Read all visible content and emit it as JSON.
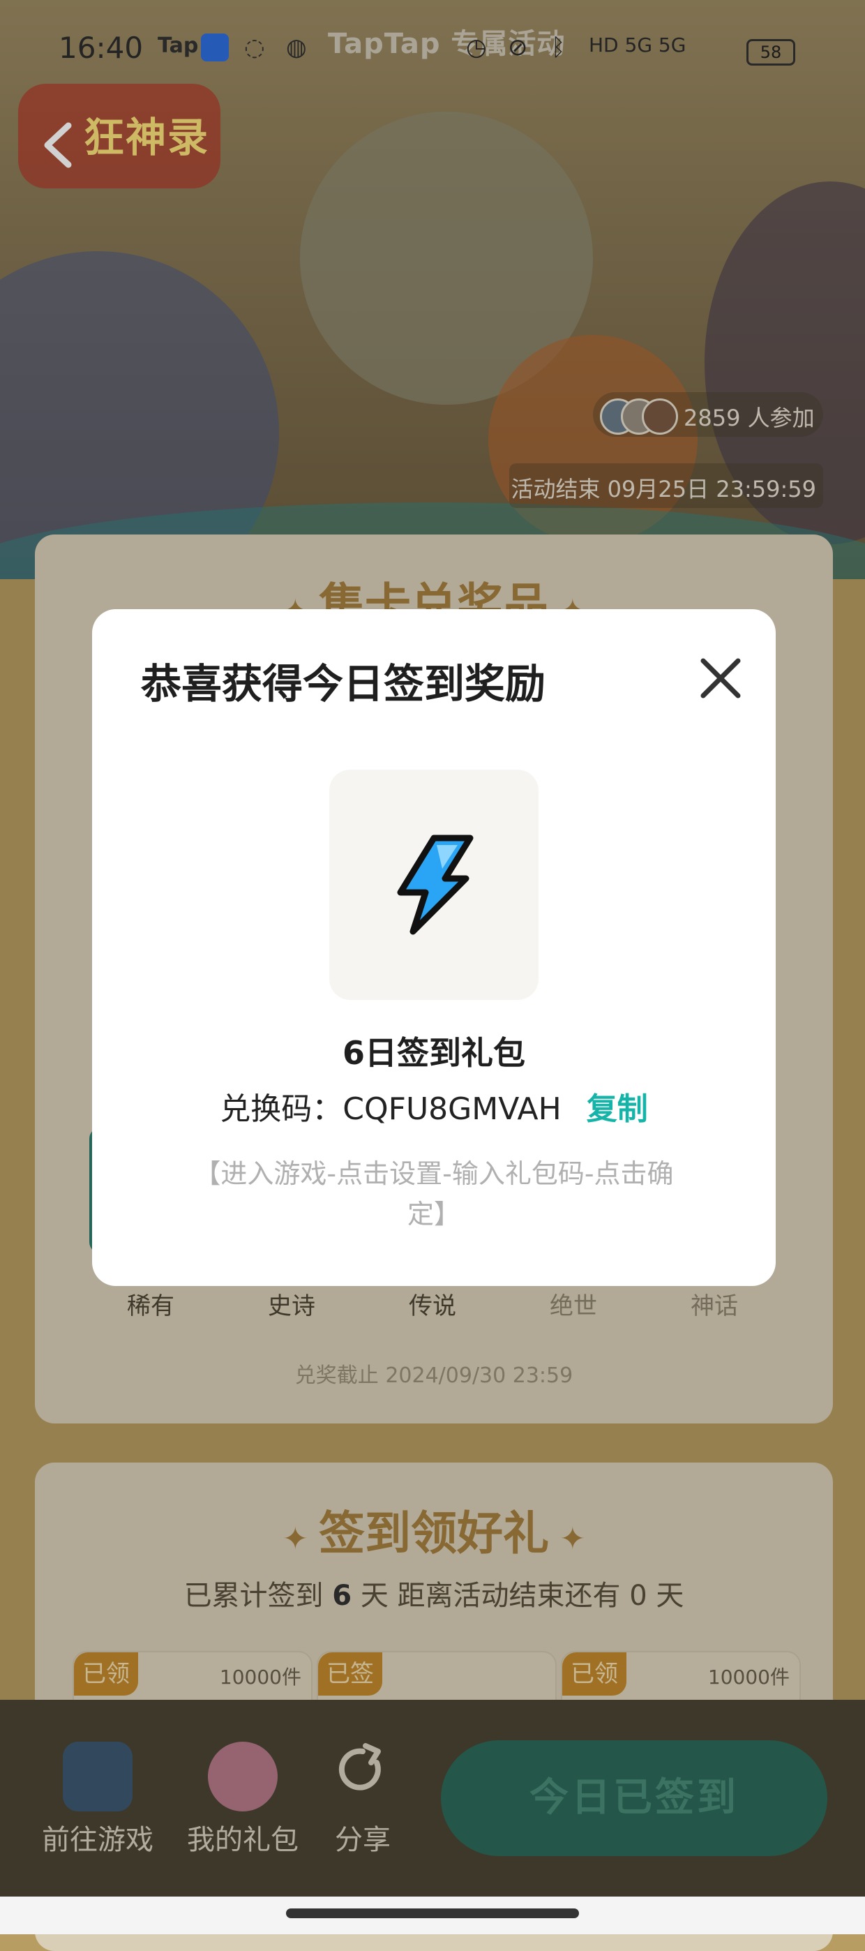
{
  "status_bar": {
    "time": "16:40",
    "app_tap": "Tap",
    "watermark": "TapTap 专属活动",
    "network": "HD 5G 5G",
    "battery": "58"
  },
  "hero": {
    "game_logo": "狂神录",
    "participants": "2859 人参加",
    "deadline": "活动结束 09月25日 23:59:59"
  },
  "collect_section": {
    "title": "集卡兑奖品",
    "tiers": [
      "稀有",
      "史诗",
      "传说",
      "绝世",
      "神话"
    ],
    "redeem_deadline": "兑奖截止 2024/09/30 23:59"
  },
  "signin_section": {
    "title": "签到领好礼",
    "stats_prefix": "已累计签到 ",
    "days": "6",
    "stats_suffix": " 天  距离活动结束还有 0 天",
    "slots": [
      {
        "tag": "已领",
        "count": "10000件"
      },
      {
        "tag": "已签",
        "count": ""
      },
      {
        "tag": "已领",
        "count": "10000件"
      }
    ]
  },
  "bottom_nav": {
    "go_game": "前往游戏",
    "my_gifts": "我的礼包",
    "share": "分享",
    "signed_button": "今日已签到"
  },
  "modal": {
    "title": "恭喜获得今日签到奖励",
    "gift_name": "6日签到礼包",
    "code_label": "兑换码：",
    "code_value": "CQFU8GMVAH",
    "copy_label": "复制",
    "hint": "【进入游戏-点击设置-输入礼包码-点击确定】"
  },
  "colors": {
    "accent": "#16b4a8",
    "tag_orange": "#c48a2e",
    "gold": "#a6803f"
  }
}
